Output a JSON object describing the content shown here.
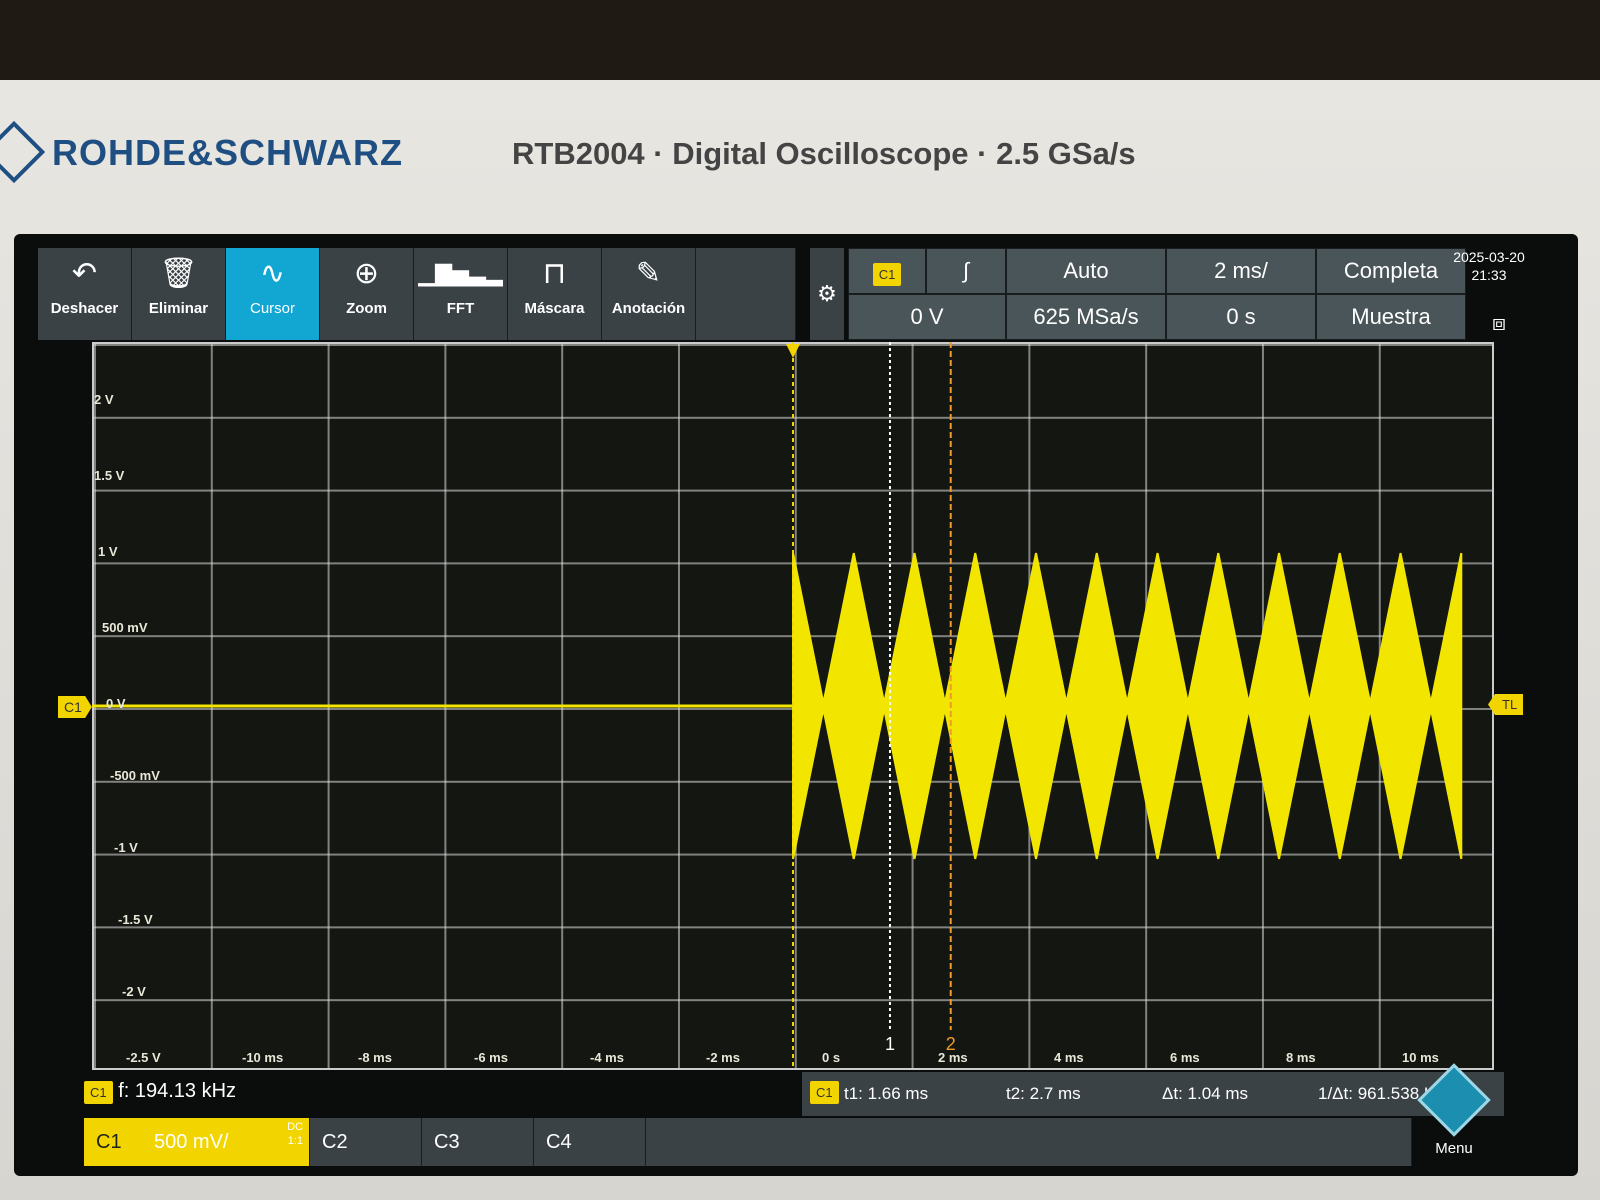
{
  "brand": {
    "name": "ROHDE&SCHWARZ",
    "model_line": "RTB2004 · Digital Oscilloscope · 2.5 GSa/s"
  },
  "toolbar": {
    "buttons": [
      {
        "label": "Deshacer",
        "icon": "undo-icon"
      },
      {
        "label": "Eliminar",
        "icon": "trash-icon"
      },
      {
        "label": "Cursor",
        "icon": "cursor-wave-icon",
        "active": true
      },
      {
        "label": "Zoom",
        "icon": "zoom-icon"
      },
      {
        "label": "FFT",
        "icon": "fft-icon"
      },
      {
        "label": "Máscara",
        "icon": "mask-icon"
      },
      {
        "label": "Anotación",
        "icon": "pencil-icon"
      }
    ]
  },
  "status": {
    "trigger_source": "C1",
    "trigger_level": "0 V",
    "trigger_mode": "Auto",
    "sample_rate": "625 MSa/s",
    "timebase": "2 ms/",
    "time_offset": "0 s",
    "acquisition": "Completa",
    "acq_mode": "Muestra",
    "date": "2025-03-20",
    "time": "21:33"
  },
  "graticule": {
    "y_labels": [
      "2 V",
      "1.5 V",
      "1 V",
      "500 mV",
      "0 V",
      "-500 mV",
      "-1 V",
      "-1.5 V",
      "-2 V",
      "-2.5 V"
    ],
    "x_labels": [
      "-10 ms",
      "-8 ms",
      "-6 ms",
      "-4 ms",
      "-2 ms",
      "0 s",
      "2 ms",
      "4 ms",
      "6 ms",
      "8 ms",
      "10 ms"
    ],
    "channel_marker": "C1",
    "trigger_level_marker": "TL",
    "cursor1_label": "1",
    "cursor2_label": "2"
  },
  "chart_data": {
    "type": "line",
    "series": [
      {
        "name": "C1"
      }
    ],
    "signal": {
      "burst_start_ms": 0,
      "envelope_peak_V": 1.05,
      "envelope_period_ms": 1.04,
      "baseline_V": 0
    },
    "xlim": [
      -12,
      12
    ],
    "ylim": [
      -2.5,
      2.5
    ],
    "cursors_ms": [
      1.66,
      2.7
    ],
    "colors": {
      "trace": "#f2e600",
      "grid": "#d8d8d8"
    }
  },
  "footer": {
    "frequency_channel": "C1",
    "frequency_text": "f: 194.13 kHz",
    "cursor_channel": "C1",
    "t1": "t1: 1.66 ms",
    "t2": "t2: 2.7 ms",
    "dt": "Δt: 1.04 ms",
    "inv_dt": "1/Δt: 961.538 H",
    "menu_label": "Menu",
    "channels": [
      {
        "label": "C1",
        "scale": "500 mV/",
        "coupling": "DC",
        "probe": "1:1",
        "active": true
      },
      {
        "label": "C2"
      },
      {
        "label": "C3"
      },
      {
        "label": "C4"
      }
    ]
  }
}
